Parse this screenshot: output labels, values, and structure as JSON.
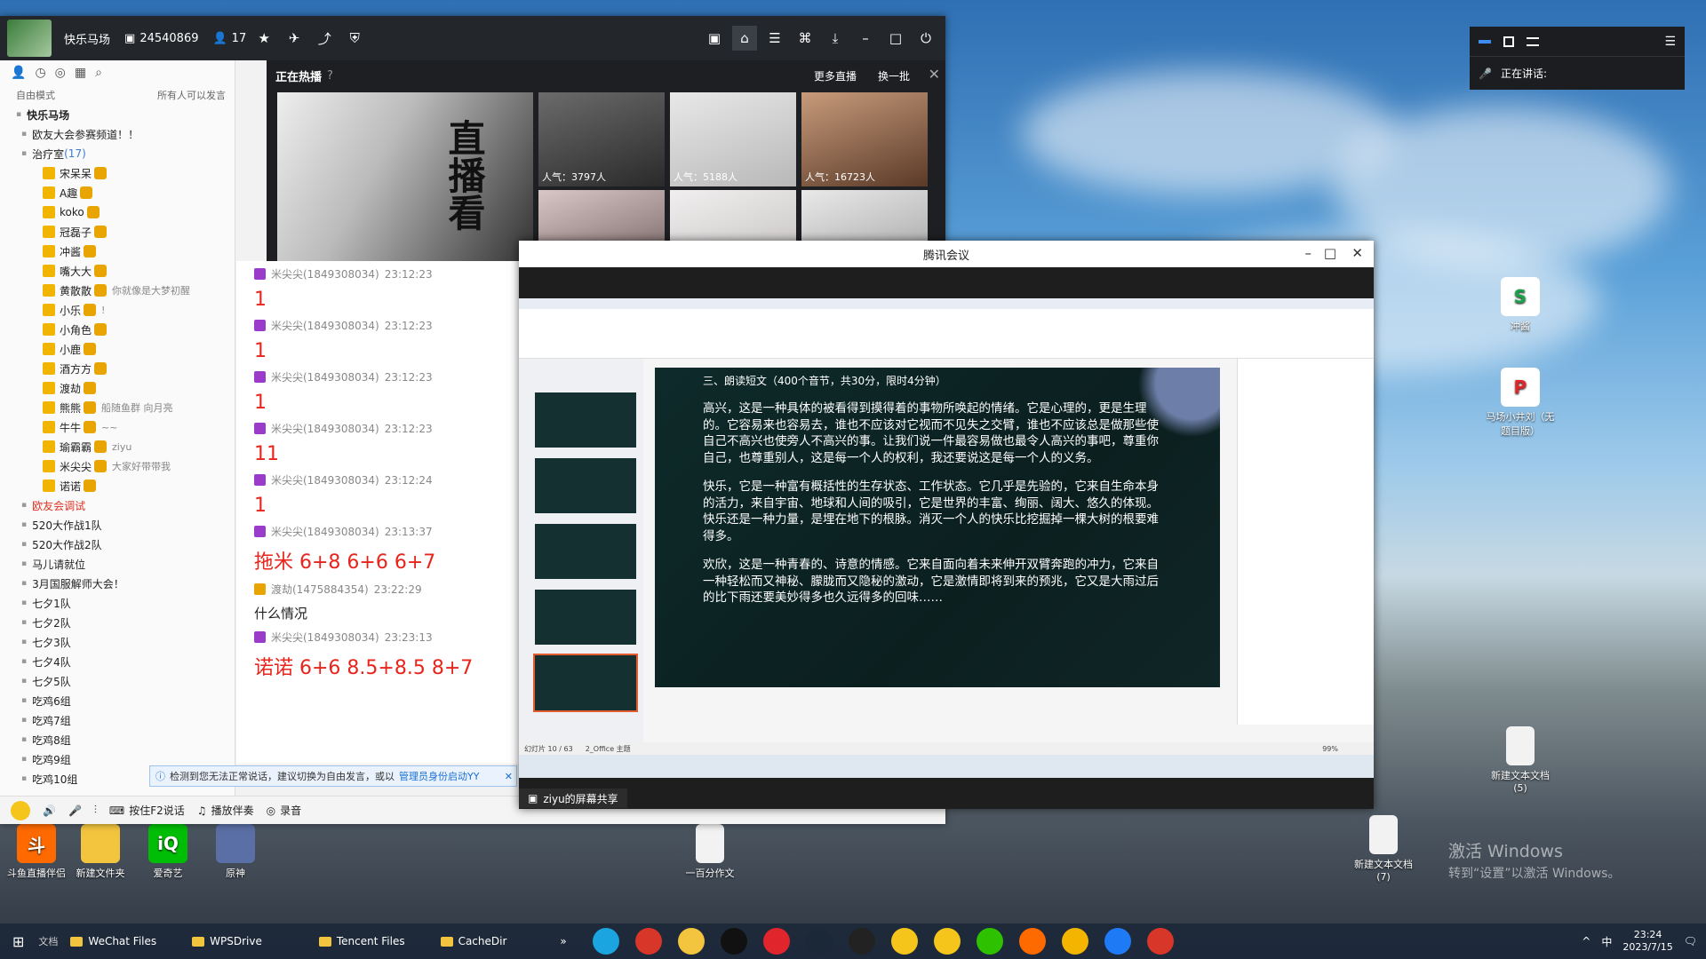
{
  "desktop": {
    "left_icons": [
      {
        "label": "斗鱼直播伴侣"
      },
      {
        "label": "新建文件夹"
      },
      {
        "label": "爱奇艺"
      },
      {
        "label": "原神"
      }
    ],
    "mid_icon": {
      "label": "一百分作文"
    },
    "right_icons": [
      {
        "label": "冲酱"
      },
      {
        "label": "马场小井刘（无题目版）"
      },
      {
        "label": "新建文本文档 (5)"
      },
      {
        "label": "新建文本文档 (7)"
      }
    ],
    "watermark_line1": "激活 Windows",
    "watermark_line2": "转到“设置”以激活 Windows。"
  },
  "taskbar": {
    "search_label": "文档",
    "folders": [
      "WeChat Files",
      "WPSDrive",
      "Tencent Files",
      "CacheDir"
    ],
    "more_label": "»",
    "apps": [
      {
        "name": "edge",
        "color": "#1aa4e0"
      },
      {
        "name": "wps",
        "color": "#d9362a"
      },
      {
        "name": "explorer",
        "color": "#f3c43d"
      },
      {
        "name": "qq",
        "color": "#111111"
      },
      {
        "name": "netease-music",
        "color": "#e0262c"
      },
      {
        "name": "steam",
        "color": "#1b2838"
      },
      {
        "name": "obs",
        "color": "#222222"
      },
      {
        "name": "yy",
        "color": "#f5c51c"
      },
      {
        "name": "yy2",
        "color": "#f5c51c"
      },
      {
        "name": "wechat",
        "color": "#2dc100"
      },
      {
        "name": "douyu",
        "color": "#ff6a00"
      },
      {
        "name": "chrome",
        "color": "#f4b400"
      },
      {
        "name": "tencent-meeting",
        "color": "#1f7af5"
      },
      {
        "name": "wps-office",
        "color": "#d9362a"
      }
    ],
    "tray": {
      "caret": "^",
      "ime": "中",
      "time": "23:24",
      "date": "2023/7/15"
    }
  },
  "yy": {
    "channel_name": "快乐马场",
    "channel_id": "24540869",
    "online_count": "17",
    "left": {
      "mode": "自由模式",
      "speak_rule": "所有人可以发言",
      "tree": [
        {
          "label": "快乐马场",
          "level": 0,
          "bold": true
        },
        {
          "label": "欧友大会参赛频道！！",
          "level": 1
        },
        {
          "label": "治疗室",
          "count": "(17)",
          "level": 1
        },
        {
          "label": "宋呆呆",
          "level": 2,
          "note": ""
        },
        {
          "label": "A趣",
          "level": 2,
          "note": ""
        },
        {
          "label": "koko",
          "level": 2,
          "note": ""
        },
        {
          "label": "冠磊子",
          "level": 2,
          "note": ""
        },
        {
          "label": "冲酱",
          "level": 2,
          "note": ""
        },
        {
          "label": "嘴大大",
          "level": 2,
          "note": ""
        },
        {
          "label": "黄散散",
          "level": 2,
          "note": "你就像是大梦初醒"
        },
        {
          "label": "小乐",
          "level": 2,
          "note": "!"
        },
        {
          "label": "小角色",
          "level": 2,
          "note": ""
        },
        {
          "label": "小鹿",
          "level": 2,
          "note": ""
        },
        {
          "label": "酒方方",
          "level": 2,
          "note": ""
        },
        {
          "label": "渡劫",
          "level": 2,
          "note": ""
        },
        {
          "label": "熊熊",
          "level": 2,
          "note": "船随鱼群 向月亮"
        },
        {
          "label": "牛牛",
          "level": 2,
          "note": "~~"
        },
        {
          "label": "瑜霸霸",
          "level": 2,
          "note": "ziyu"
        },
        {
          "label": "米尖尖",
          "level": 2,
          "note": "大家好带带我"
        },
        {
          "label": "诺诺",
          "level": 2,
          "note": ""
        },
        {
          "label": "欧友会调试",
          "level": 1,
          "red": true
        },
        {
          "label": "520大作战1队",
          "level": 1
        },
        {
          "label": "520大作战2队",
          "level": 1
        },
        {
          "label": "马儿请就位",
          "level": 1
        },
        {
          "label": "3月国服解师大会！",
          "level": 1
        },
        {
          "label": "七夕1队",
          "level": 1
        },
        {
          "label": "七夕2队",
          "level": 1
        },
        {
          "label": "七夕3队",
          "level": 1
        },
        {
          "label": "七夕4队",
          "level": 1
        },
        {
          "label": "七夕5队",
          "level": 1
        },
        {
          "label": "吃鸡6组",
          "level": 1
        },
        {
          "label": "吃鸡7组",
          "level": 1
        },
        {
          "label": "吃鸡8组",
          "level": 1
        },
        {
          "label": "吃鸡9组",
          "level": 1
        },
        {
          "label": "吃鸡10组",
          "level": 1
        }
      ]
    },
    "hot": {
      "title": "正在热播",
      "more": "更多直播",
      "refresh": "换一批",
      "banner_text": "直播看",
      "thumbs": [
        {
          "popularity": "人气：3797人"
        },
        {
          "popularity": "人气：5188人"
        },
        {
          "popularity": "人气：16723人"
        },
        {
          "popularity": ""
        },
        {
          "popularity": ""
        },
        {
          "popularity": ""
        }
      ]
    },
    "chat": [
      {
        "user": "米尖尖(1849308034)",
        "time": "23:12:23",
        "text": "1"
      },
      {
        "user": "米尖尖(1849308034)",
        "time": "23:12:23",
        "text": "1"
      },
      {
        "user": "米尖尖(1849308034)",
        "time": "23:12:23",
        "text": "1"
      },
      {
        "user": "米尖尖(1849308034)",
        "time": "23:12:23",
        "text": "11"
      },
      {
        "user": "米尖尖(1849308034)",
        "time": "23:12:24",
        "text": "1"
      },
      {
        "user": "米尖尖(1849308034)",
        "time": "23:13:37",
        "text": "拖米 6+8 6+6 6+7"
      },
      {
        "user": "渡劫(1475884354)",
        "time": "23:22:29",
        "text": "什么情况",
        "plain": true
      },
      {
        "user": "米尖尖(1849308034)",
        "time": "23:23:13",
        "text": "诺诺 6+6 8.5+8.5 8+7"
      }
    ],
    "notice": {
      "text": "检测到您无法正常说话，建议切换为自由发言，或以",
      "link": "管理员身份启动YY"
    },
    "bottom": {
      "f2": "按住F2说话",
      "music": "播放伴奏",
      "record": "录音"
    }
  },
  "meeting": {
    "title": "腾讯会议",
    "share_label": "ziyu的屏幕共享",
    "slide": {
      "header": "三、朗读短文（400个音节，共30分，限时4分钟）",
      "paragraphs": [
        "高兴，这是一种具体的被看得到摸得着的事物所唤起的情绪。它是心理的，更是生理的。它容易来也容易去，谁也不应该对它视而不见失之交臂，谁也不应该总是做那些使自己不高兴也使旁人不高兴的事。让我们说一件最容易做也最令人高兴的事吧，尊重你自己，也尊重别人，这是每一个人的权利，我还要说这是每一个人的义务。",
        "快乐，它是一种富有概括性的生存状态、工作状态。它几乎是先验的，它来自生命本身的活力，来自宇宙、地球和人间的吸引，它是世界的丰富、绚丽、阔大、悠久的体现。快乐还是一种力量，是埋在地下的根脉。消灭一个人的快乐比挖掘掉一棵大树的根要难得多。",
        "欢欣，这是一种青春的、诗意的情感。它来自面向着未来伸开双臂奔跑的冲力，它来自一种轻松而又神秘、朦胧而又隐秘的激动，它是激情即将到来的预兆，它又是大雨过后的比下雨还要美妙得多也久远得多的回味……"
      ]
    },
    "status": {
      "page": "幻灯片 10 / 63",
      "theme": "2_Office 主题",
      "zoom": "99%"
    }
  },
  "mini": {
    "speaking_label": "正在讲话:"
  }
}
